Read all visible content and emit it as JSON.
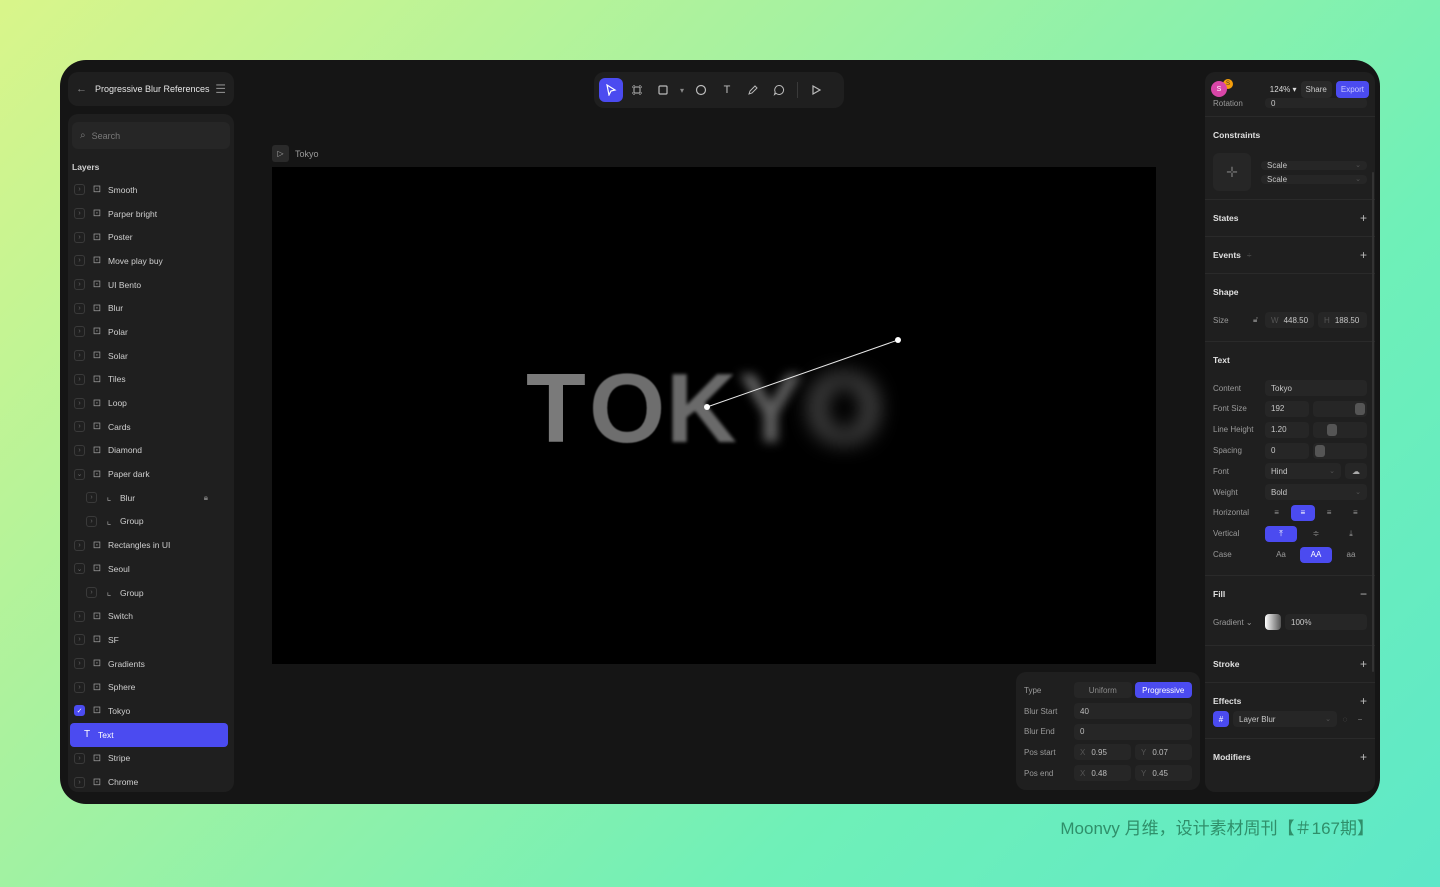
{
  "header": {
    "title": "Progressive Blur References",
    "back_icon": "arrow-left-icon",
    "menu_icon": "hamburger-menu-icon"
  },
  "search": {
    "placeholder": "Search"
  },
  "layers": {
    "label": "Layers",
    "items": [
      {
        "name": "Smooth",
        "kind": "frame",
        "indent": 0,
        "expanded": false
      },
      {
        "name": "Parper bright",
        "kind": "frame",
        "indent": 0,
        "expanded": false
      },
      {
        "name": "Poster",
        "kind": "frame",
        "indent": 0,
        "expanded": false
      },
      {
        "name": "Move play buy",
        "kind": "frame",
        "indent": 0,
        "expanded": false
      },
      {
        "name": "UI Bento",
        "kind": "frame",
        "indent": 0,
        "expanded": false
      },
      {
        "name": "Blur",
        "kind": "frame",
        "indent": 0,
        "expanded": false
      },
      {
        "name": "Polar",
        "kind": "frame",
        "indent": 0,
        "expanded": false
      },
      {
        "name": "Solar",
        "kind": "frame",
        "indent": 0,
        "expanded": false
      },
      {
        "name": "Tiles",
        "kind": "frame",
        "indent": 0,
        "expanded": false
      },
      {
        "name": "Loop",
        "kind": "frame",
        "indent": 0,
        "expanded": false
      },
      {
        "name": "Cards",
        "kind": "frame",
        "indent": 0,
        "expanded": false
      },
      {
        "name": "Diamond",
        "kind": "frame",
        "indent": 0,
        "expanded": false
      },
      {
        "name": "Paper dark",
        "kind": "frame",
        "indent": 0,
        "expanded": true
      },
      {
        "name": "Blur",
        "kind": "group",
        "indent": 1,
        "expanded": false,
        "locked": true
      },
      {
        "name": "Group",
        "kind": "group",
        "indent": 1,
        "expanded": false
      },
      {
        "name": "Rectangles in UI",
        "kind": "frame",
        "indent": 0,
        "expanded": false
      },
      {
        "name": "Seoul",
        "kind": "frame",
        "indent": 0,
        "expanded": true
      },
      {
        "name": "Group",
        "kind": "group",
        "indent": 1,
        "expanded": false
      },
      {
        "name": "Switch",
        "kind": "frame",
        "indent": 0,
        "expanded": false
      },
      {
        "name": "SF",
        "kind": "frame",
        "indent": 0,
        "expanded": false
      },
      {
        "name": "Gradients",
        "kind": "frame",
        "indent": 0,
        "expanded": false
      },
      {
        "name": "Sphere",
        "kind": "frame",
        "indent": 0,
        "expanded": false
      },
      {
        "name": "Tokyo",
        "kind": "frame",
        "indent": 0,
        "expanded": true,
        "checked": true
      },
      {
        "name": "Text",
        "kind": "text",
        "indent": 1,
        "selected": true
      },
      {
        "name": "Stripe",
        "kind": "frame",
        "indent": 0,
        "expanded": false
      },
      {
        "name": "Chrome",
        "kind": "frame",
        "indent": 0,
        "expanded": false
      }
    ]
  },
  "toolbar": {
    "tools": [
      "cursor-icon",
      "frame-icon",
      "rectangle-icon",
      "chevron-down-icon",
      "ellipse-icon",
      "text-icon",
      "pen-icon",
      "comment-icon",
      "play-icon"
    ],
    "active": "cursor-icon"
  },
  "canvas": {
    "frame_label": "Tokyo",
    "text": "TOKYO",
    "background": "#000000"
  },
  "blur_panel": {
    "type_label": "Type",
    "type_options": [
      "Uniform",
      "Progressive"
    ],
    "type_active": "Progressive",
    "blur_start_label": "Blur Start",
    "blur_start": "40",
    "blur_end_label": "Blur End",
    "blur_end": "0",
    "pos_start_label": "Pos start",
    "pos_start_x": "0.95",
    "pos_start_y": "0.07",
    "pos_end_label": "Pos end",
    "pos_end_x": "0.48",
    "pos_end_y": "0.45",
    "x_label": "X",
    "y_label": "Y"
  },
  "right": {
    "avatar_letter": "S",
    "avatar2_letter": "S",
    "zoom": "124%",
    "share": "Share",
    "export": "Export",
    "rotation_label": "Rotation",
    "rotation": "0",
    "constraints": {
      "title": "Constraints",
      "h": "Scale",
      "v": "Scale"
    },
    "states": {
      "title": "States"
    },
    "events": {
      "title": "Events"
    },
    "shape": {
      "title": "Shape",
      "size_label": "Size",
      "w_label": "W",
      "w": "448.50",
      "h_label": "H",
      "h": "188.50"
    },
    "text": {
      "title": "Text",
      "content_label": "Content",
      "content": "Tokyo",
      "font_size_label": "Font Size",
      "font_size": "192",
      "line_height_label": "Line Height",
      "line_height": "1.20",
      "spacing_label": "Spacing",
      "spacing": "0",
      "font_label": "Font",
      "font": "Hind",
      "weight_label": "Weight",
      "weight": "Bold",
      "horizontal_label": "Horizontal",
      "vertical_label": "Vertical",
      "case_label": "Case",
      "case_options": [
        "Aa",
        "AA",
        "aa"
      ]
    },
    "fill": {
      "title": "Fill",
      "type": "Gradient",
      "opacity": "100%"
    },
    "stroke": {
      "title": "Stroke"
    },
    "effects": {
      "title": "Effects",
      "item": "Layer Blur"
    },
    "modifiers": {
      "title": "Modifiers"
    }
  },
  "watermark": "Moonvy 月维，设计素材周刊【＃167期】",
  "colors": {
    "accent": "#4b4bf0",
    "panel": "#1f1f1f",
    "app_bg": "#151515"
  }
}
